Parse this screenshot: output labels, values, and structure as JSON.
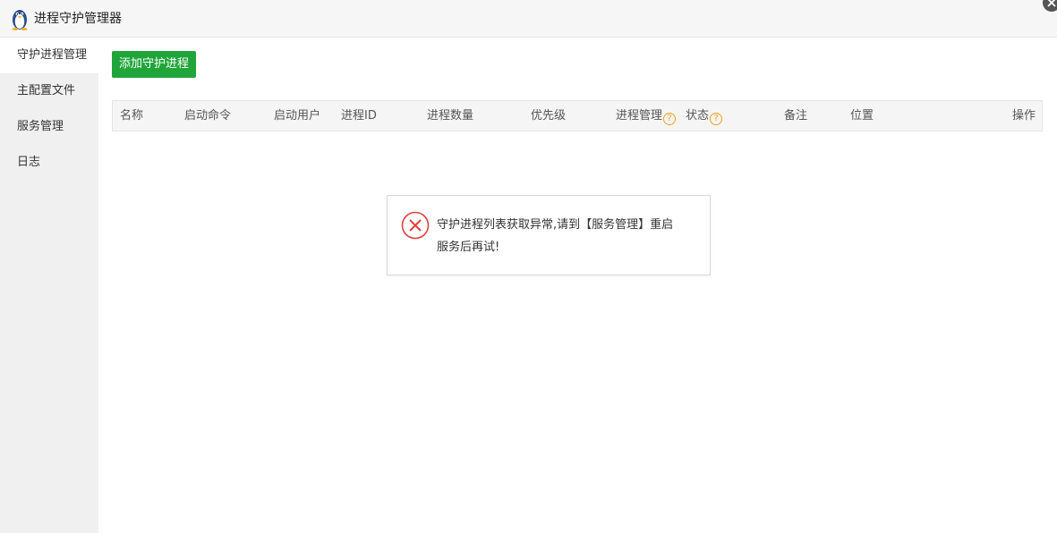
{
  "app": {
    "title": "进程守护管理器"
  },
  "sidebar": {
    "items": [
      {
        "label": "守护进程管理",
        "active": true
      },
      {
        "label": "主配置文件",
        "active": false
      },
      {
        "label": "服务管理",
        "active": false
      },
      {
        "label": "日志",
        "active": false
      }
    ]
  },
  "toolbar": {
    "add_label": "添加守护进程"
  },
  "table": {
    "columns": [
      "名称",
      "启动命令",
      "启动用户",
      "进程ID",
      "进程数量",
      "优先级",
      "进程管理",
      "状态",
      "备注",
      "位置",
      "操作"
    ],
    "help_icon": "?"
  },
  "dialog": {
    "line1": "守护进程列表获取异常,请到【服务管理】重启",
    "line2": "服务后再试!"
  },
  "colors": {
    "accent": "#20a53a",
    "error": "#e04040",
    "help": "#f0a020"
  }
}
